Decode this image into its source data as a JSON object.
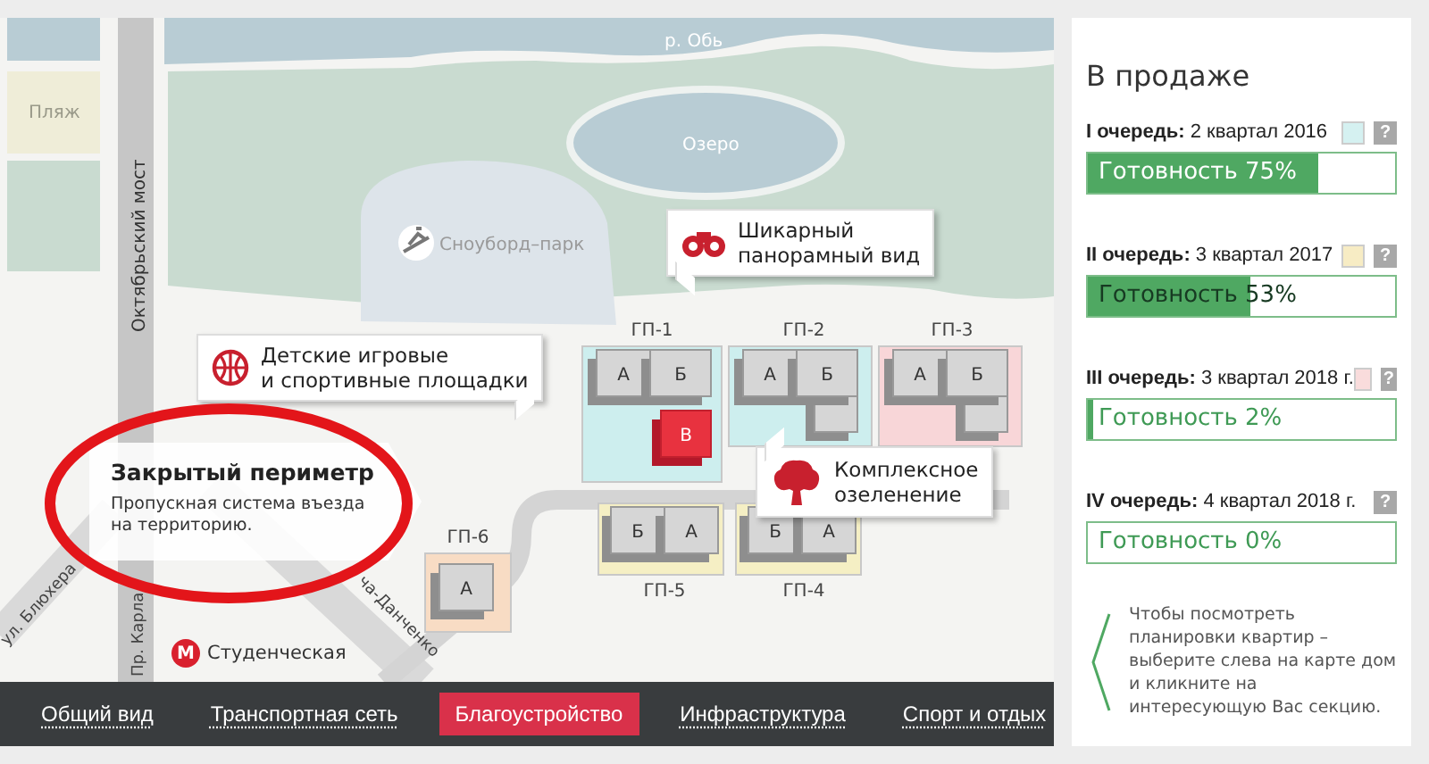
{
  "map": {
    "river_label": "р. Обь",
    "beach_label": "Пляж",
    "lake_label": "Озеро",
    "park_label": "Сноуборд–парк",
    "bridge_label": "Октябрьский мост",
    "streets": [
      "ул. Блюхера",
      "Пр. Карла",
      "ча-Данченко"
    ],
    "buildings": [
      {
        "label": "ГП-1",
        "color": "#cdeeee",
        "sections": [
          {
            "label": "А",
            "selected": false
          },
          {
            "label": "Б",
            "selected": false
          },
          {
            "label": "В",
            "selected": true
          }
        ]
      },
      {
        "label": "ГП-2",
        "color": "#cdeeee",
        "sections": [
          {
            "label": "А",
            "selected": false
          },
          {
            "label": "Б",
            "selected": false
          }
        ]
      },
      {
        "label": "ГП-3",
        "color": "#f8d6d8",
        "sections": [
          {
            "label": "А",
            "selected": false
          },
          {
            "label": "Б",
            "selected": false
          }
        ]
      },
      {
        "label": "ГП-6",
        "color": "#f8dcc4",
        "sections": [
          {
            "label": "А",
            "selected": false
          }
        ]
      },
      {
        "label": "ГП-5",
        "color": "#f5efc4",
        "sections": [
          {
            "label": "Б",
            "selected": false
          },
          {
            "label": "А",
            "selected": false
          }
        ]
      },
      {
        "label": "ГП-4",
        "color": "#f5efc4",
        "sections": [
          {
            "label": "Б",
            "selected": false
          },
          {
            "label": "А",
            "selected": false
          }
        ]
      }
    ],
    "callouts": [
      {
        "kind": "playground",
        "lines": [
          "Детские игровые",
          "и спортивные площадки"
        ]
      },
      {
        "kind": "panorama",
        "lines": [
          "Шикарный",
          "панорамный вид"
        ]
      },
      {
        "kind": "greenery",
        "lines": [
          "Комплексное",
          "озеленение"
        ]
      }
    ],
    "perimeter": {
      "title": "Закрытый периметр",
      "text": "Пропускная система въезда на территорию."
    },
    "metro": {
      "icon": "М",
      "station": "Студенческая"
    }
  },
  "nav": [
    {
      "label": "Общий вид",
      "selected": false
    },
    {
      "label": "Транспортная сеть",
      "selected": false
    },
    {
      "label": "Благоустройство",
      "selected": true
    },
    {
      "label": "Инфраструктура",
      "selected": false
    },
    {
      "label": "Спорт и отдых",
      "selected": false
    }
  ],
  "sale": {
    "title": "В продаже",
    "queues": [
      {
        "name": "**I очередь:** 2 квартал 2016",
        "color": "#d5f1f1",
        "help": "?",
        "level": 0.75,
        "reading": "Готовность 75%"
      },
      {
        "name": "**II очередь:** 3 квартал 2017",
        "color": "#f7ecc4",
        "help": "?",
        "level": 0.53,
        "reading": "Готовность 53%"
      },
      {
        "name": "**III очередь:** 3 квартал 2018 г.",
        "color": "#f9dcdc",
        "help": "?",
        "level": 0.02,
        "reading": "Готовность 2%"
      },
      {
        "name": "**IV очередь:** 4 квартал 2018 г.",
        "help": "?",
        "reading": "Готовность 0%"
      }
    ],
    "hint": "Чтобы посмотреть планировки квартир – выберите слева на карте дом и кликните на интересующую Вас секцию."
  }
}
